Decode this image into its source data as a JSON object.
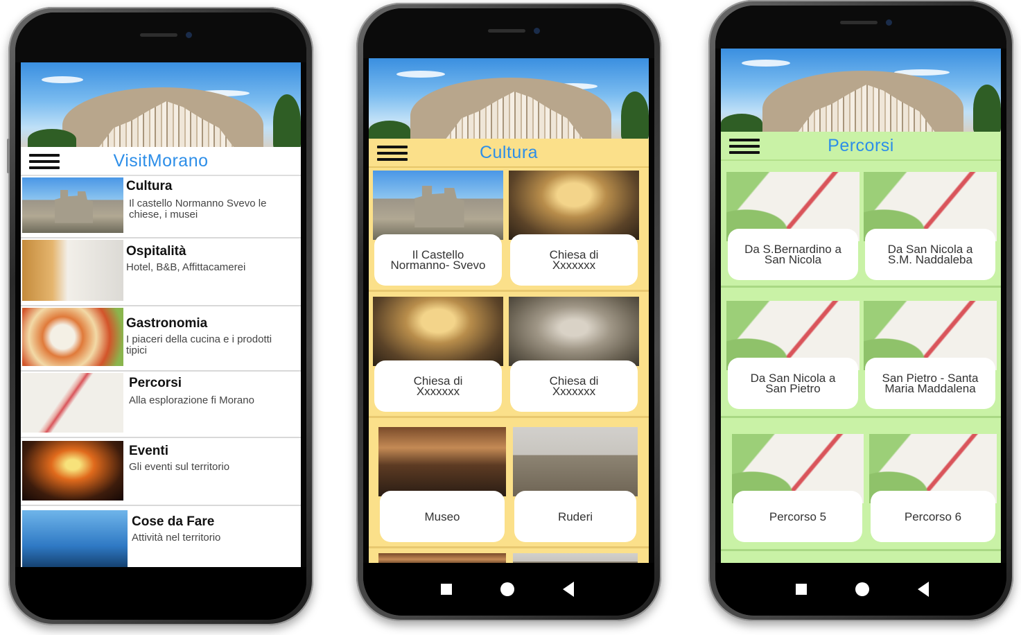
{
  "phones": [
    {
      "title": "VisitMorano",
      "rows": [
        {
          "title": "Cultura",
          "subtitle": "Il castello Normanno Svevo le chiese, i musei"
        },
        {
          "title": "Ospitalità",
          "subtitle": "Hotel, B&B, Affittacamerei"
        },
        {
          "title": "Gastronomia",
          "subtitle": "I piaceri della cucina e i prodotti tipici"
        },
        {
          "title": "Percorsi",
          "subtitle": "Alla esplorazione fi Morano"
        },
        {
          "title": "Eventi",
          "subtitle": "Gli eventi sul territorio"
        },
        {
          "title": "Cose da Fare",
          "subtitle": "Attività nel territorio"
        }
      ]
    },
    {
      "title": "Cultura",
      "accent": "#fbe08a",
      "tiles": [
        {
          "label": "Il Castello\nNormanno- Svevo"
        },
        {
          "label": "Chiesa  di\nXxxxxxx"
        },
        {
          "label": "Chiesa  di\nXxxxxxx"
        },
        {
          "label": "Chiesa  di\nXxxxxxx"
        },
        {
          "label": "Museo"
        },
        {
          "label": "Ruderi"
        }
      ]
    },
    {
      "title": "Percorsi",
      "accent": "#c9f2a6",
      "tiles": [
        {
          "label": "Da S.Bernardino a\nSan Nicola"
        },
        {
          "label": "Da San Nicola a\nS.M. Naddaleba"
        },
        {
          "label": "Da San Nicola  a\nSan Pietro"
        },
        {
          "label": "San Pietro - Santa\nMaria Maddalena"
        },
        {
          "label": "Percorso 5"
        },
        {
          "label": "Percorso 6"
        }
      ]
    }
  ],
  "icons": {
    "menu": "hamburger-menu-icon",
    "nav_square": "recent-apps-icon",
    "nav_circle": "home-icon",
    "nav_back": "back-icon"
  },
  "colors": {
    "title_blue": "#2d8ee8",
    "cultura_bg": "#fbe08a",
    "percorsi_bg": "#c9f2a6"
  }
}
